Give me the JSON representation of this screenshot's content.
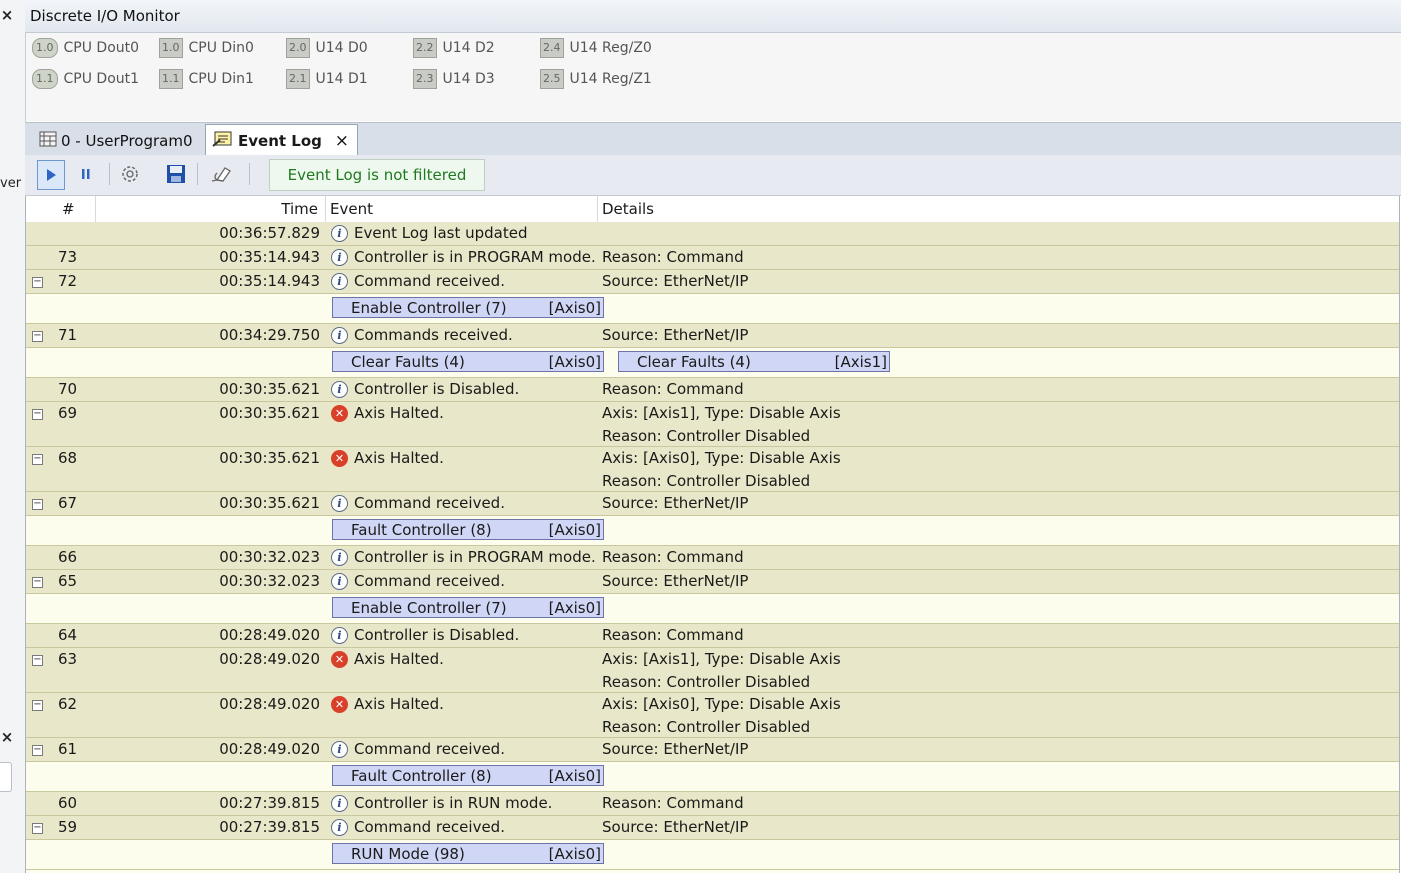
{
  "left_sliver": {
    "close_top": "×",
    "close_bottom": "×",
    "partial_text": "ver"
  },
  "io_monitor": {
    "title": "Discrete I/O Monitor",
    "items": [
      {
        "badge": "1.0",
        "label": "CPU Dout0",
        "round": true
      },
      {
        "badge": "1.0",
        "label": "CPU Din0",
        "round": false
      },
      {
        "badge": "2.0",
        "label": "U14 D0",
        "round": false
      },
      {
        "badge": "2.2",
        "label": "U14 D2",
        "round": false
      },
      {
        "badge": "2.4",
        "label": "U14 Reg/Z0",
        "round": false
      },
      {
        "badge": "1.1",
        "label": "CPU Dout1",
        "round": true
      },
      {
        "badge": "1.1",
        "label": "CPU Din1",
        "round": false
      },
      {
        "badge": "2.1",
        "label": "U14 D1",
        "round": false
      },
      {
        "badge": "2.3",
        "label": "U14 D3",
        "round": false
      },
      {
        "badge": "2.5",
        "label": "U14 Reg/Z1",
        "round": false
      }
    ]
  },
  "tabs": [
    {
      "label": "0 - UserProgram0",
      "active": false
    },
    {
      "label": "Event Log",
      "active": true,
      "close": "×"
    }
  ],
  "toolbar": {
    "icons": [
      "play-icon",
      "pause-icon",
      "settings-icon",
      "save-icon",
      "clear-icon"
    ],
    "filter_status": "Event Log is not filtered"
  },
  "grid": {
    "columns": {
      "num": "#",
      "time": "Time",
      "event": "Event",
      "details": "Details"
    },
    "rows": [
      {
        "type": "main",
        "num": "",
        "time": "00:36:57.829",
        "icon": "info",
        "event": "Event Log last updated",
        "details": [],
        "expander": false
      },
      {
        "type": "main",
        "num": "73",
        "time": "00:35:14.943",
        "icon": "info",
        "event": "Controller is in PROGRAM mode.",
        "details": [
          "Reason: Command"
        ],
        "expander": false
      },
      {
        "type": "main",
        "num": "72",
        "time": "00:35:14.943",
        "icon": "info",
        "event": "Command received.",
        "details": [
          "Source: EtherNet/IP"
        ],
        "expander": true
      },
      {
        "type": "sub",
        "commands": [
          {
            "name": "Enable Controller (7)",
            "axis": "[Axis0]"
          }
        ]
      },
      {
        "type": "main",
        "num": "71",
        "time": "00:34:29.750",
        "icon": "info",
        "event": "Commands received.",
        "details": [
          "Source: EtherNet/IP"
        ],
        "expander": true
      },
      {
        "type": "sub",
        "commands": [
          {
            "name": "Clear Faults (4)",
            "axis": "[Axis0]"
          },
          {
            "name": "Clear Faults (4)",
            "axis": "[Axis1]"
          }
        ]
      },
      {
        "type": "main",
        "num": "70",
        "time": "00:30:35.621",
        "icon": "info",
        "event": "Controller is Disabled.",
        "details": [
          "Reason: Command"
        ],
        "expander": false
      },
      {
        "type": "main",
        "num": "69",
        "time": "00:30:35.621",
        "icon": "error",
        "event": "Axis Halted.",
        "details": [
          "Axis: [Axis1], Type: Disable Axis",
          "Reason: Controller Disabled"
        ],
        "expander": true
      },
      {
        "type": "main",
        "num": "68",
        "time": "00:30:35.621",
        "icon": "error",
        "event": "Axis Halted.",
        "details": [
          "Axis: [Axis0], Type: Disable Axis",
          "Reason: Controller Disabled"
        ],
        "expander": true
      },
      {
        "type": "main",
        "num": "67",
        "time": "00:30:35.621",
        "icon": "info",
        "event": "Command received.",
        "details": [
          "Source: EtherNet/IP"
        ],
        "expander": true
      },
      {
        "type": "sub",
        "commands": [
          {
            "name": "Fault Controller (8)",
            "axis": "[Axis0]"
          }
        ]
      },
      {
        "type": "main",
        "num": "66",
        "time": "00:30:32.023",
        "icon": "info",
        "event": "Controller is in PROGRAM mode.",
        "details": [
          "Reason: Command"
        ],
        "expander": false
      },
      {
        "type": "main",
        "num": "65",
        "time": "00:30:32.023",
        "icon": "info",
        "event": "Command received.",
        "details": [
          "Source: EtherNet/IP"
        ],
        "expander": true
      },
      {
        "type": "sub",
        "commands": [
          {
            "name": "Enable Controller (7)",
            "axis": "[Axis0]"
          }
        ]
      },
      {
        "type": "main",
        "num": "64",
        "time": "00:28:49.020",
        "icon": "info",
        "event": "Controller is Disabled.",
        "details": [
          "Reason: Command"
        ],
        "expander": false
      },
      {
        "type": "main",
        "num": "63",
        "time": "00:28:49.020",
        "icon": "error",
        "event": "Axis Halted.",
        "details": [
          "Axis: [Axis1], Type: Disable Axis",
          "Reason: Controller Disabled"
        ],
        "expander": true
      },
      {
        "type": "main",
        "num": "62",
        "time": "00:28:49.020",
        "icon": "error",
        "event": "Axis Halted.",
        "details": [
          "Axis: [Axis0], Type: Disable Axis",
          "Reason: Controller Disabled"
        ],
        "expander": true
      },
      {
        "type": "main",
        "num": "61",
        "time": "00:28:49.020",
        "icon": "info",
        "event": "Command received.",
        "details": [
          "Source: EtherNet/IP"
        ],
        "expander": true
      },
      {
        "type": "sub",
        "commands": [
          {
            "name": "Fault Controller (8)",
            "axis": "[Axis0]"
          }
        ]
      },
      {
        "type": "main",
        "num": "60",
        "time": "00:27:39.815",
        "icon": "info",
        "event": "Controller is in RUN mode.",
        "details": [
          "Reason: Command"
        ],
        "expander": false
      },
      {
        "type": "main",
        "num": "59",
        "time": "00:27:39.815",
        "icon": "info",
        "event": "Command received.",
        "details": [
          "Source: EtherNet/IP"
        ],
        "expander": true
      },
      {
        "type": "sub",
        "commands": [
          {
            "name": "RUN Mode (98)",
            "axis": "[Axis0]"
          }
        ]
      }
    ]
  }
}
